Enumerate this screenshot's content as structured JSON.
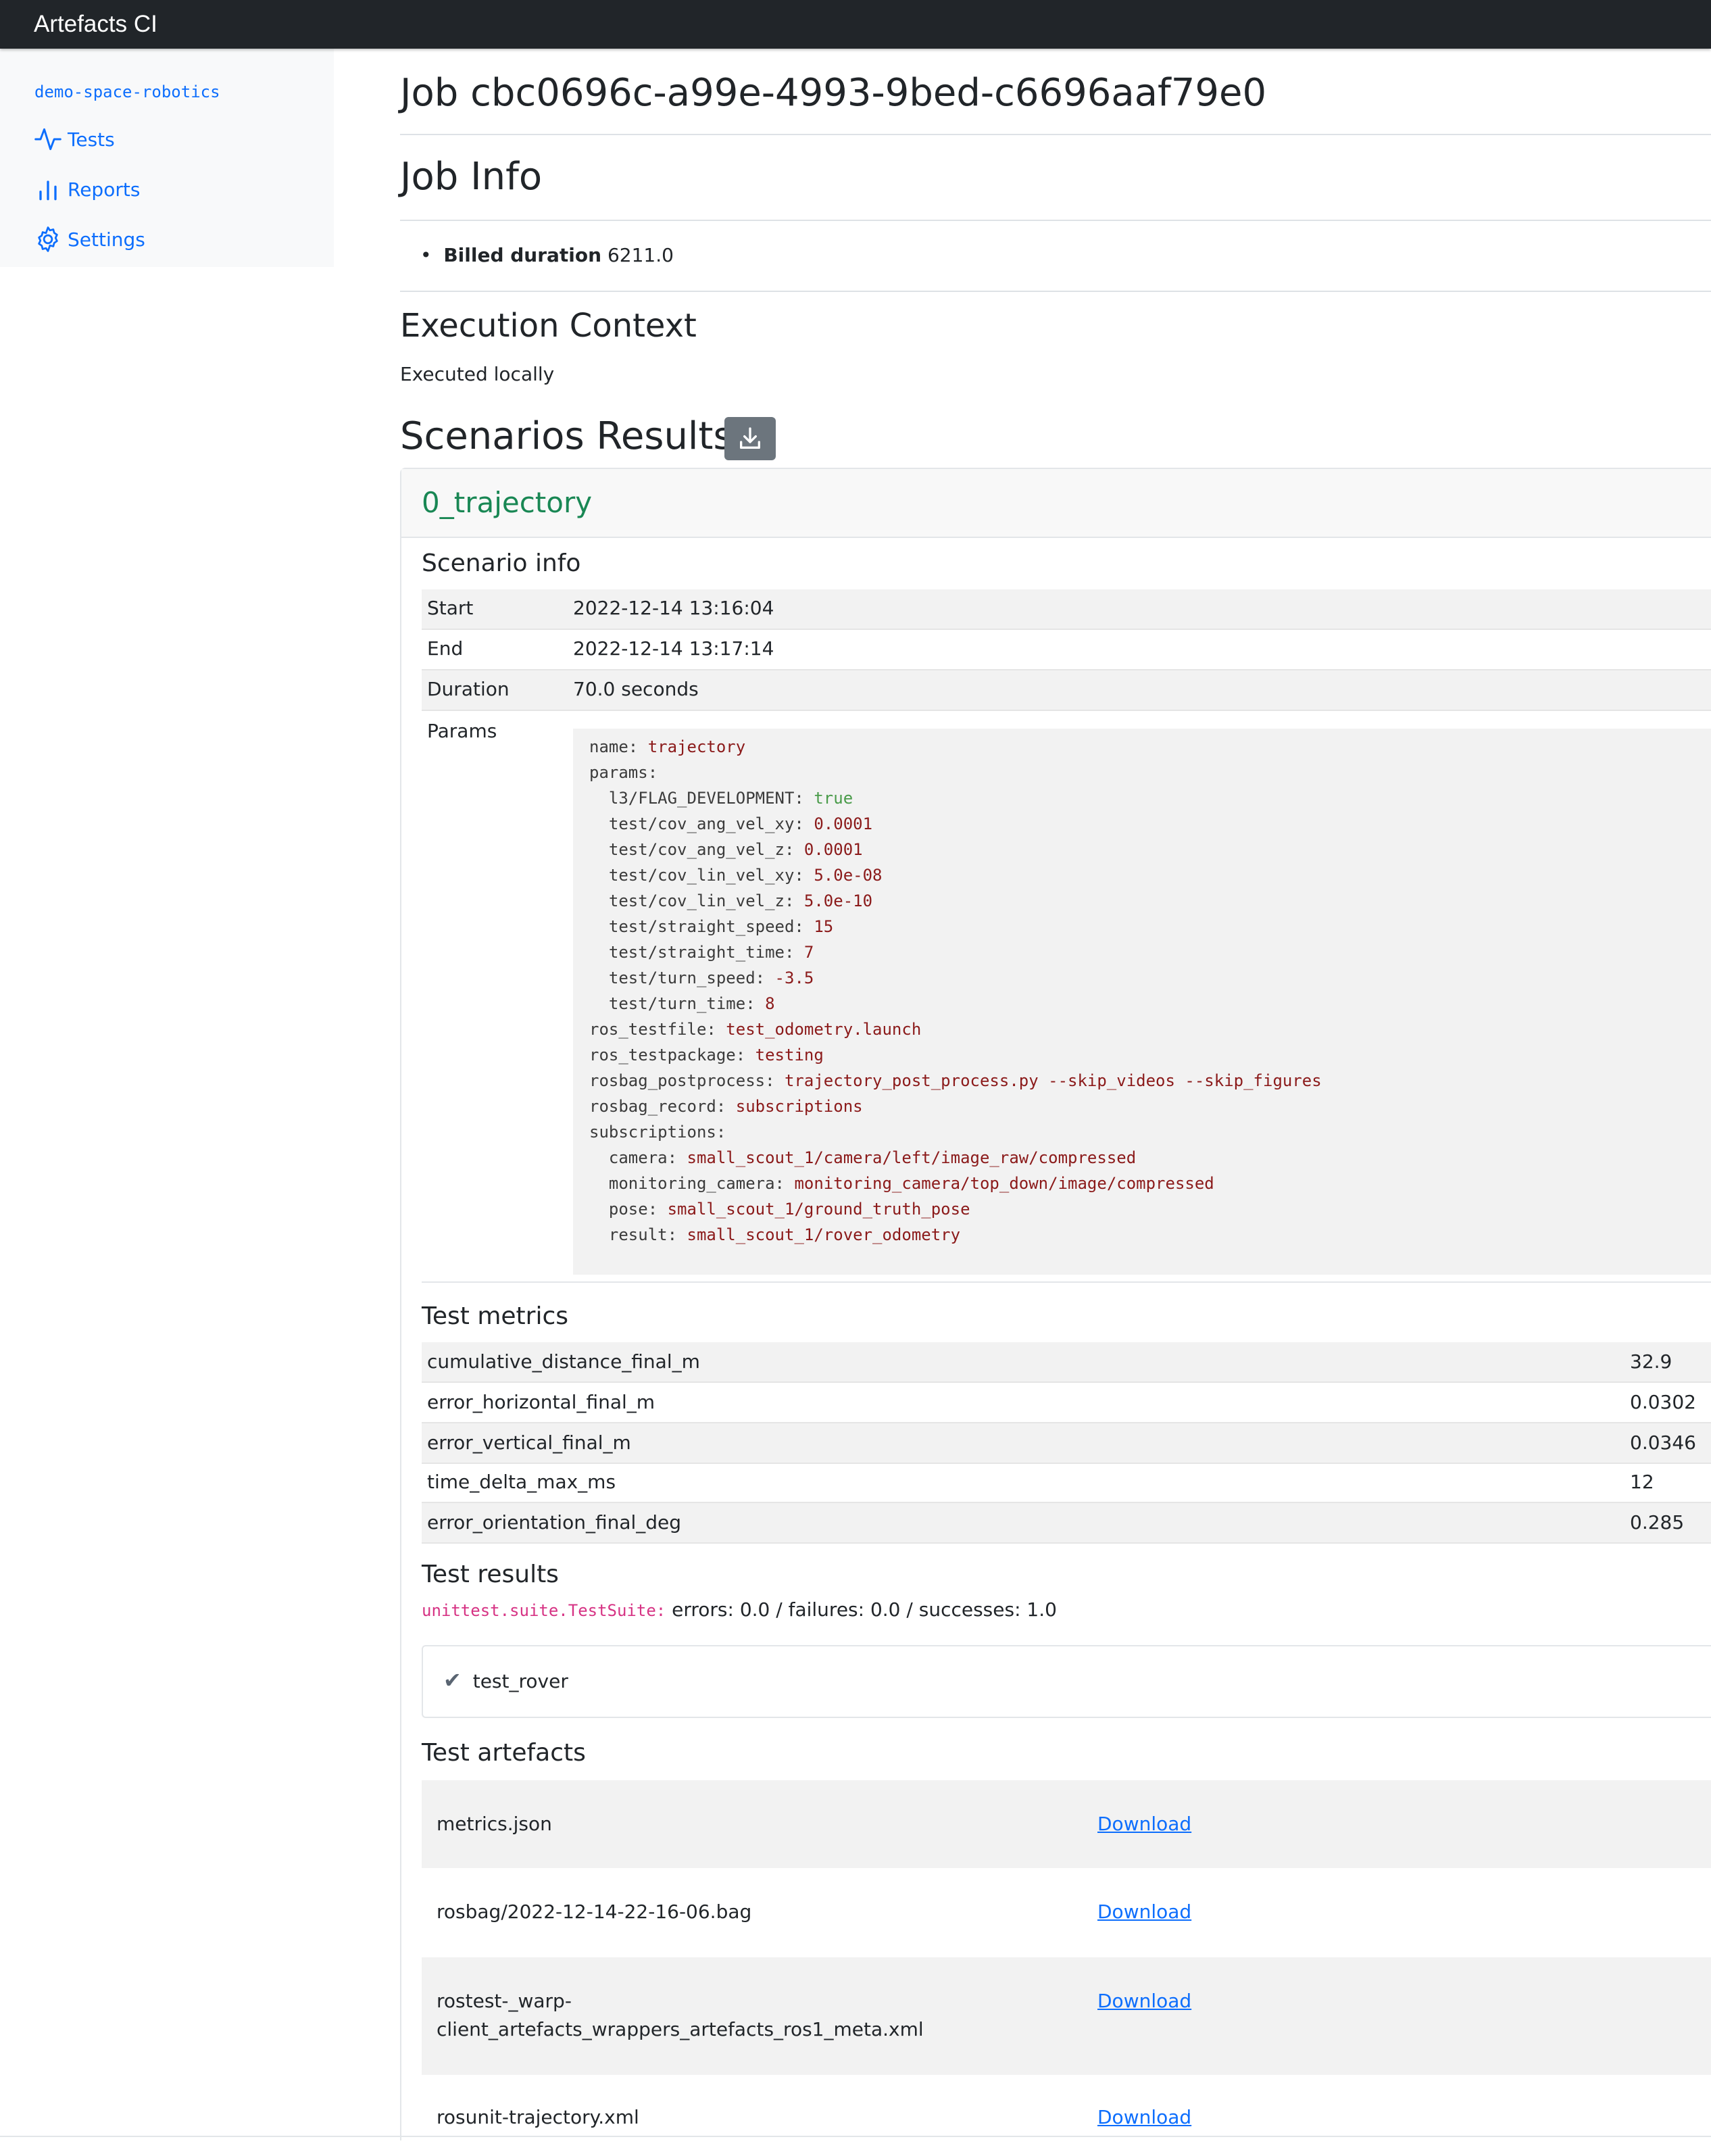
{
  "app": {
    "brand": "Artefacts CI"
  },
  "sidebar": {
    "project": "demo-space-robotics",
    "items": [
      {
        "label": "Tests",
        "icon": "activity-icon"
      },
      {
        "label": "Reports",
        "icon": "bar-chart-icon"
      },
      {
        "label": "Settings",
        "icon": "gear-icon"
      }
    ]
  },
  "job": {
    "title": "Job cbc0696c-a99e-4993-9bed-c6696aaf79e0",
    "info_heading": "Job Info",
    "billed_label": "Billed duration",
    "billed_value": "6211.0",
    "exec_heading": "Execution Context",
    "exec_value": "Executed locally",
    "scenarios_heading": "Scenarios Results"
  },
  "scenario": {
    "name": "0_trajectory",
    "info_title": "Scenario info",
    "info": [
      {
        "key": "Start",
        "value": "2022-12-14 13:16:04"
      },
      {
        "key": "End",
        "value": "2022-12-14 13:17:14"
      },
      {
        "key": "Duration",
        "value": "70.0 seconds"
      }
    ],
    "params_label": "Params",
    "params_lines": [
      {
        "k": "name: ",
        "v": "trajectory",
        "t": "s"
      },
      {
        "k": "params:",
        "v": "",
        "t": ""
      },
      {
        "k": "  l3/FLAG_DEVELOPMENT: ",
        "v": "true",
        "t": "g"
      },
      {
        "k": "  test/cov_ang_vel_xy: ",
        "v": "0.0001",
        "t": "s"
      },
      {
        "k": "  test/cov_ang_vel_z: ",
        "v": "0.0001",
        "t": "s"
      },
      {
        "k": "  test/cov_lin_vel_xy: ",
        "v": "5.0e-08",
        "t": "s"
      },
      {
        "k": "  test/cov_lin_vel_z: ",
        "v": "5.0e-10",
        "t": "s"
      },
      {
        "k": "  test/straight_speed: ",
        "v": "15",
        "t": "s"
      },
      {
        "k": "  test/straight_time: ",
        "v": "7",
        "t": "s"
      },
      {
        "k": "  test/turn_speed: ",
        "v": "-3.5",
        "t": "s"
      },
      {
        "k": "  test/turn_time: ",
        "v": "8",
        "t": "s"
      },
      {
        "k": "ros_testfile: ",
        "v": "test_odometry.launch",
        "t": "s"
      },
      {
        "k": "ros_testpackage: ",
        "v": "testing",
        "t": "s"
      },
      {
        "k": "rosbag_postprocess: ",
        "v": "trajectory_post_process.py --skip_videos --skip_figures",
        "t": "s"
      },
      {
        "k": "rosbag_record: ",
        "v": "subscriptions",
        "t": "s"
      },
      {
        "k": "subscriptions:",
        "v": "",
        "t": ""
      },
      {
        "k": "  camera: ",
        "v": "small_scout_1/camera/left/image_raw/compressed",
        "t": "s"
      },
      {
        "k": "  monitoring_camera: ",
        "v": "monitoring_camera/top_down/image/compressed",
        "t": "s"
      },
      {
        "k": "  pose: ",
        "v": "small_scout_1/ground_truth_pose",
        "t": "s"
      },
      {
        "k": "  result: ",
        "v": "small_scout_1/rover_odometry",
        "t": "s"
      }
    ],
    "metrics_title": "Test metrics",
    "metrics": [
      {
        "name": "cumulative_distance_final_m",
        "value": "32.9"
      },
      {
        "name": "error_horizontal_final_m",
        "value": "0.0302"
      },
      {
        "name": "error_vertical_final_m",
        "value": "0.0346"
      },
      {
        "name": "time_delta_max_ms",
        "value": "12"
      },
      {
        "name": "error_orientation_final_deg",
        "value": "0.285"
      }
    ],
    "results_title": "Test results",
    "suite_name": "unittest.suite.TestSuite:",
    "suite_summary": " errors: 0.0 / failures: 0.0 / successes: 1.0",
    "test_mark": "✔",
    "test_name": "test_rover",
    "artefacts_title": "Test artefacts",
    "download_label": "Download",
    "artefacts": [
      {
        "line1": "metrics.json",
        "line2": ""
      },
      {
        "line1": "rosbag/2022-12-14-22-16-06.bag",
        "line2": ""
      },
      {
        "line1": "rostest-_warp-",
        "line2": "client_artefacts_wrappers_artefacts_ros1_meta.xml"
      },
      {
        "line1": "rosunit-trajectory.xml",
        "line2": ""
      }
    ]
  }
}
